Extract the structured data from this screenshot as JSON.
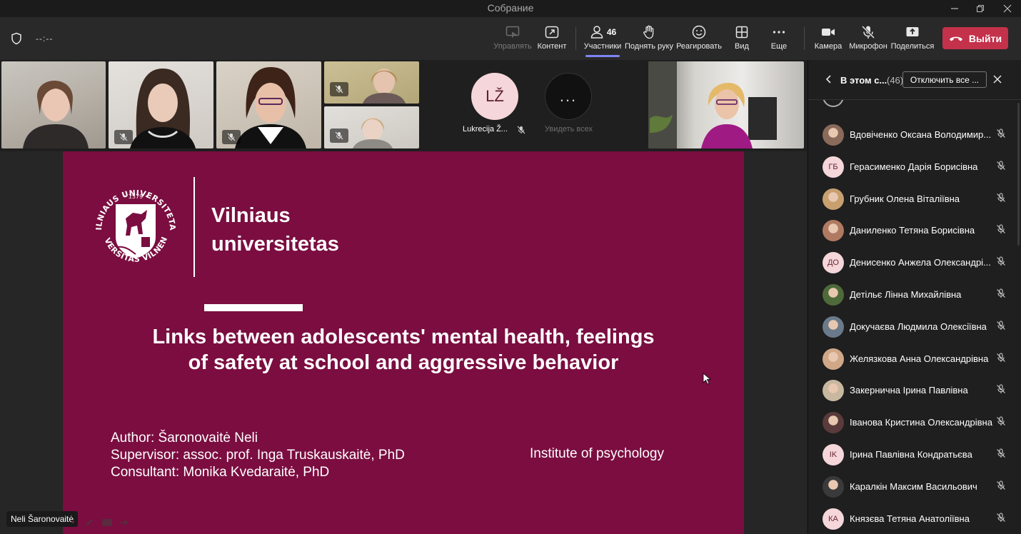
{
  "window": {
    "title": "Собрание"
  },
  "toolbar": {
    "timer": "--:--",
    "manage_label": "Управлять",
    "content_label": "Контент",
    "participants_label": "Участники",
    "participants_count": "46",
    "raise_hand_label": "Поднять руку",
    "react_label": "Реагировать",
    "view_label": "Вид",
    "more_label": "Еще",
    "camera_label": "Камера",
    "mic_label": "Микрофон",
    "share_label": "Поделиться",
    "leave_label": "Выйти",
    "leave_color": "#c4314b",
    "active_color": "#7f85f5"
  },
  "strip": {
    "lz_initials": "LŽ",
    "lz_name": "Lukrecija Ž...",
    "see_all_label": "Увидеть всех",
    "see_all_glyph": "..."
  },
  "slide": {
    "seal_top": "VILNIAUS UNIVERSITETAS",
    "seal_bottom": "UNIVERSITAS VILNENSIS",
    "seal_year": "1579",
    "university_line1": "Vilniaus",
    "university_line2": "universitetas",
    "headline_line1": "Links between adolescents' mental health, feelings",
    "headline_line2": "of safety at school and aggressive behavior",
    "author": "Author: Šaronovaitė Neli",
    "supervisor": "Supervisor: assoc. prof. Inga Truskauskaitė, PhD",
    "consultant": "Consultant: Monika Kvedaraitė, PhD",
    "institute": "Institute of psychology",
    "bg_color": "#7b0d40"
  },
  "presenter_tag": "Neli Šaronovaitė",
  "panel": {
    "title": "В этом с...",
    "count": "(46)",
    "mute_all_label": "Отключить все ...",
    "participants": [
      {
        "name": "Вдовіченко Оксана Володимир...",
        "initials": "",
        "avatar": "photo"
      },
      {
        "name": "Герасименко Дарія Борисівна",
        "initials": "ГБ",
        "avatar": "initials"
      },
      {
        "name": "Грубник Олена Віталіївна",
        "initials": "",
        "avatar": "photo"
      },
      {
        "name": "Даниленко Тетяна Борисівна",
        "initials": "",
        "avatar": "photo"
      },
      {
        "name": "Денисенко Анжела Олександрі...",
        "initials": "ДО",
        "avatar": "initials"
      },
      {
        "name": "Детільє Лінна Михайлівна",
        "initials": "",
        "avatar": "photo"
      },
      {
        "name": "Докучаєва Людмила Олексіївна",
        "initials": "",
        "avatar": "photo"
      },
      {
        "name": "Желязкова Анна Олександрівна",
        "initials": "",
        "avatar": "photo"
      },
      {
        "name": "Закернична Ірина Павлівна",
        "initials": "",
        "avatar": "photo"
      },
      {
        "name": "Іванова Кристина Олександрівна",
        "initials": "",
        "avatar": "photo"
      },
      {
        "name": "Ірина Павлівна Кондратьєва",
        "initials": "IK",
        "avatar": "initials"
      },
      {
        "name": "Каралкін Максим Васильович",
        "initials": "",
        "avatar": "photo"
      },
      {
        "name": "Князєва Тетяна Анатоліївна",
        "initials": "КА",
        "avatar": "initials"
      }
    ]
  }
}
